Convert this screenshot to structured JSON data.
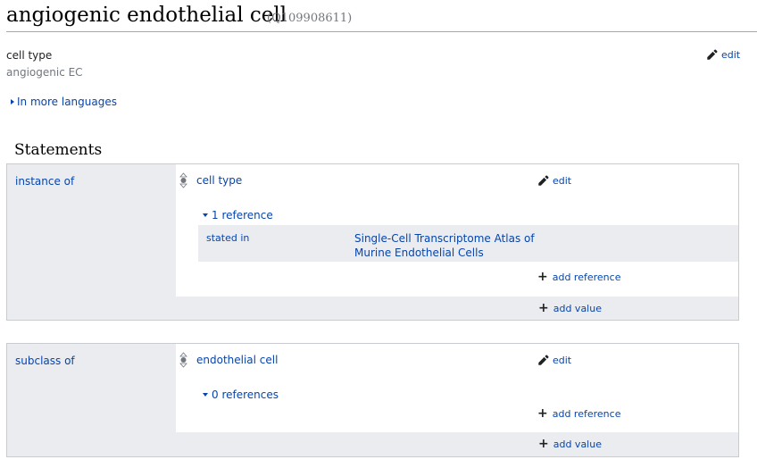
{
  "heading": {
    "title": "angiogenic endothelial cell",
    "qid": "(Q109908611)"
  },
  "description": {
    "label": "cell type",
    "alias": "angiogenic EC",
    "edit_label": "edit"
  },
  "languages_label": "In more languages",
  "statements_heading": "Statements",
  "statements": [
    {
      "property": "instance of",
      "value": "cell type",
      "edit_label": "edit",
      "references_label": "1 reference",
      "reference": {
        "property": "stated in",
        "value": "Single-Cell Transcriptome Atlas of Murine Endothelial Cells"
      },
      "add_reference_label": "add reference",
      "add_value_label": "add value"
    },
    {
      "property": "subclass of",
      "value": "endothelial cell",
      "edit_label": "edit",
      "references_label": "0 references",
      "add_reference_label": "add reference",
      "add_value_label": "add value"
    }
  ],
  "colors": {
    "link": "#0645ad",
    "panel_bg": "#eaecf0",
    "border": "#c8ccd1",
    "muted": "#72777d"
  }
}
